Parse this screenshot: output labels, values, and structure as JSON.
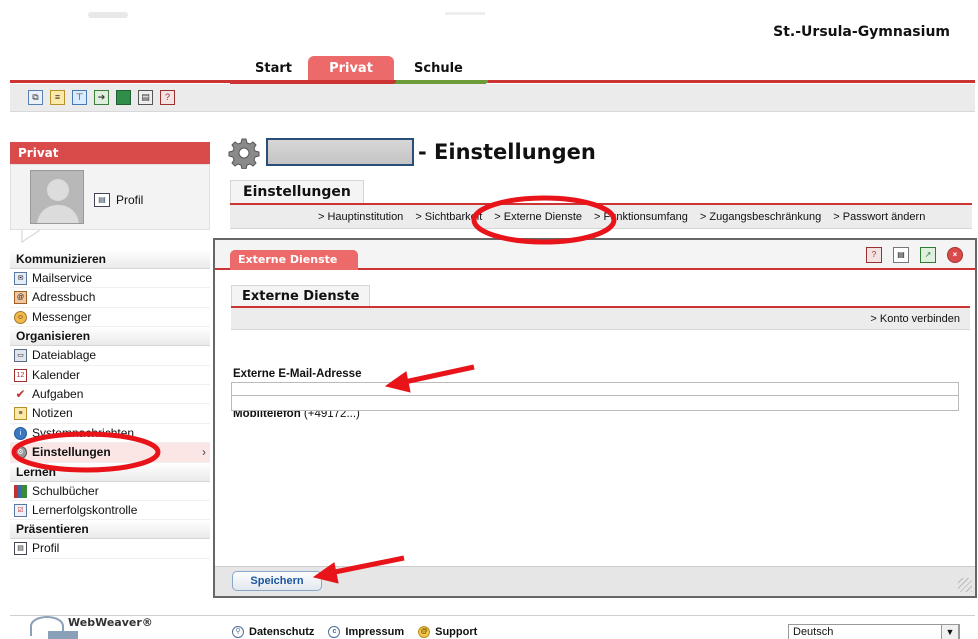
{
  "header": {
    "school_name": "St.-Ursula-Gymnasium"
  },
  "tabs": [
    {
      "label": "Start"
    },
    {
      "label": "Privat"
    },
    {
      "label": "Schule"
    }
  ],
  "toolbar": {
    "icons": [
      "windows-icon",
      "notes-icon",
      "network-icon",
      "login-icon",
      "green-square-icon",
      "printer-icon",
      "help-icon"
    ]
  },
  "sidebar": {
    "title": "Privat",
    "profile_link": "Profil",
    "sections": [
      {
        "heading": "Kommunizieren",
        "items": [
          {
            "label": "Mailservice",
            "icon": "mail-icon"
          },
          {
            "label": "Adressbuch",
            "icon": "address-book-icon"
          },
          {
            "label": "Messenger",
            "icon": "messenger-icon"
          }
        ]
      },
      {
        "heading": "Organisieren",
        "items": [
          {
            "label": "Dateiablage",
            "icon": "folder-icon"
          },
          {
            "label": "Kalender",
            "icon": "calendar-icon"
          },
          {
            "label": "Aufgaben",
            "icon": "tasks-icon"
          },
          {
            "label": "Notizen",
            "icon": "notes-icon"
          },
          {
            "label": "Systemnachrichten",
            "icon": "info-icon"
          },
          {
            "label": "Einstellungen",
            "icon": "gear-icon",
            "active": true
          }
        ]
      },
      {
        "heading": "Lernen",
        "items": [
          {
            "label": "Schulbücher",
            "icon": "books-icon"
          },
          {
            "label": "Lernerfolgskontrolle",
            "icon": "checklist-icon"
          }
        ]
      },
      {
        "heading": "Präsentieren",
        "items": [
          {
            "label": "Profil",
            "icon": "vcard-icon"
          }
        ]
      }
    ]
  },
  "main": {
    "title_suffix": "- Einstellungen",
    "subtab": "Einstellungen",
    "breadcrumbs": [
      "> Hauptinstitution",
      "> Sichtbarkeit",
      "> Externe Dienste",
      "> Funktionsumfang",
      "> Zugangsbeschränkung",
      "> Passwort ändern"
    ]
  },
  "panel": {
    "tab": "Externe Dienste",
    "inner_tab": "Externe Dienste",
    "action_link": "> Konto verbinden",
    "fields": [
      {
        "label": "Externe E-Mail-Adresse",
        "hint": "",
        "value": ""
      },
      {
        "label": "Mobiltelefon",
        "hint": " (+49172...)",
        "value": ""
      }
    ],
    "save_label": "Speichern"
  },
  "footer": {
    "brand": "WebWeaver®",
    "links": [
      "Datenschutz",
      "Impressum",
      "Support"
    ],
    "language": "Deutsch"
  },
  "annotation_color": "#e8141a"
}
